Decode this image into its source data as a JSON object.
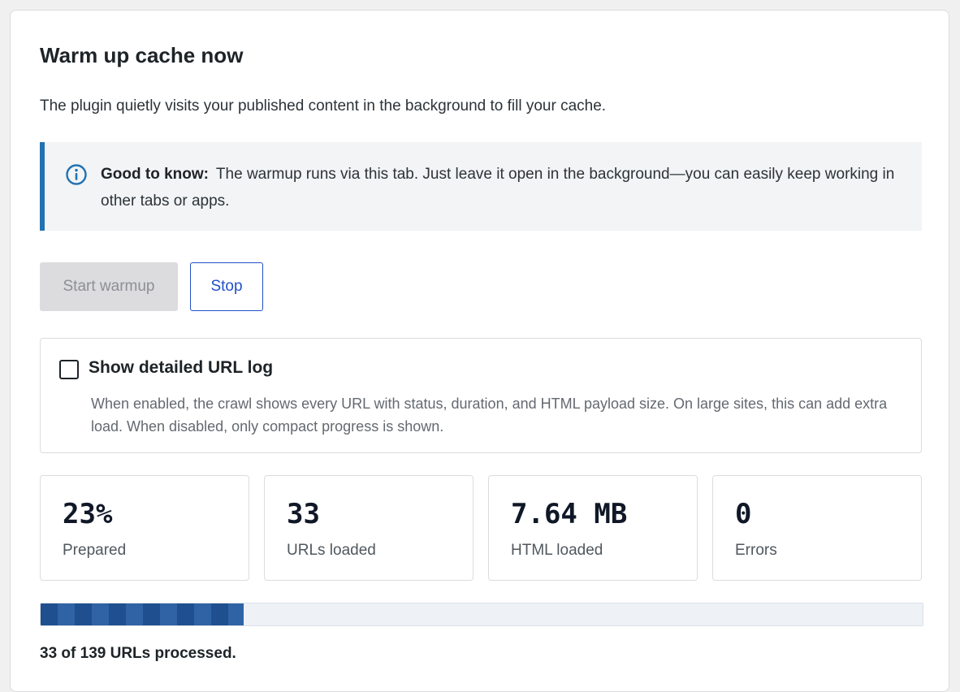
{
  "panel": {
    "title": "Warm up cache now",
    "intro": "The plugin quietly visits your published content in the background to fill your cache."
  },
  "notice": {
    "icon": "info-icon",
    "accent_color": "#2271b1",
    "heading": "Good to know:",
    "text": "The warmup runs via this tab. Just leave it open in the background—you can easily keep working in other tabs or apps."
  },
  "actions": {
    "start_label": "Start warmup",
    "start_disabled": true,
    "stop_label": "Stop"
  },
  "detailed_log": {
    "label": "Show detailed URL log",
    "checked": false,
    "help": "When enabled, the crawl shows every URL with status, duration, and HTML payload size. On large sites, this can add extra load. When disabled, only compact progress is shown."
  },
  "stats": [
    {
      "value": "23%",
      "label": "Prepared"
    },
    {
      "value": "33",
      "label": "URLs loaded"
    },
    {
      "value": "7.64 MB",
      "label": "HTML loaded"
    },
    {
      "value": "0",
      "label": "Errors"
    }
  ],
  "progress": {
    "processed": 33,
    "total": 139,
    "fill_fraction": 0.23,
    "text": "33 of 139 URLs processed."
  }
}
